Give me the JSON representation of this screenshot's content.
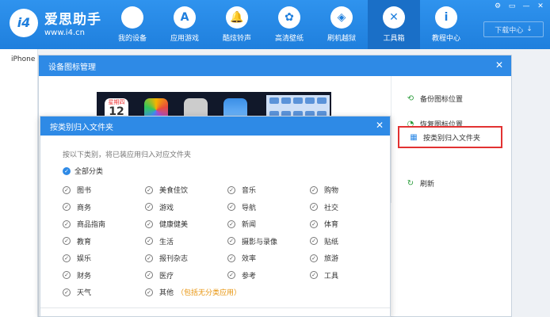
{
  "app": {
    "logo_badge": "i4",
    "name": "爱思助手",
    "url": "www.i4.cn"
  },
  "nav": [
    {
      "label": "我的设备",
      "icon": "apple-icon",
      "glyph": ""
    },
    {
      "label": "应用游戏",
      "icon": "app-store-icon",
      "glyph": "A"
    },
    {
      "label": "酷炫铃声",
      "icon": "bell-icon",
      "glyph": "🔔"
    },
    {
      "label": "高清壁纸",
      "icon": "flower-icon",
      "glyph": "✿"
    },
    {
      "label": "刷机越狱",
      "icon": "dropbox-icon",
      "glyph": "◈"
    },
    {
      "label": "工具箱",
      "icon": "tools-icon",
      "glyph": "✕"
    },
    {
      "label": "教程中心",
      "icon": "info-icon",
      "glyph": "i"
    }
  ],
  "window_controls": [
    "⚙",
    "▭",
    "—",
    "✕"
  ],
  "download_center": "下载中心",
  "download_arrow": "↓",
  "device_tab": "iPhone",
  "outer_dialog": {
    "title": "设备图标管理",
    "close": "✕",
    "calendar_weekday": "星期四",
    "calendar_day": "12",
    "menu": [
      {
        "label": "备份图标位置",
        "icon": "backup-icon",
        "glyph": "⟲"
      },
      {
        "label": "恢复图标位置",
        "icon": "restore-icon",
        "glyph": "◔"
      },
      {
        "label": "按类别归入文件夹",
        "icon": "grid-icon",
        "glyph": "▦"
      },
      {
        "label": "刷新",
        "icon": "refresh-icon",
        "glyph": "↻"
      }
    ]
  },
  "inner_dialog": {
    "title": "按类别归入文件夹",
    "close": "✕",
    "hint": "按以下类别，将已装应用归入对应文件夹",
    "all_label": "全部分类",
    "categories": [
      "图书",
      "美食佳饮",
      "音乐",
      "购物",
      "商务",
      "游戏",
      "导航",
      "社交",
      "商品指南",
      "健康健美",
      "新闻",
      "体育",
      "教育",
      "生活",
      "摄影与录像",
      "贴纸",
      "娱乐",
      "报刊杂志",
      "效率",
      "旅游",
      "财务",
      "医疗",
      "参考",
      "工具",
      "天气",
      "其他"
    ],
    "other_note": "（包括无分类应用）"
  },
  "check_glyph": "✓"
}
